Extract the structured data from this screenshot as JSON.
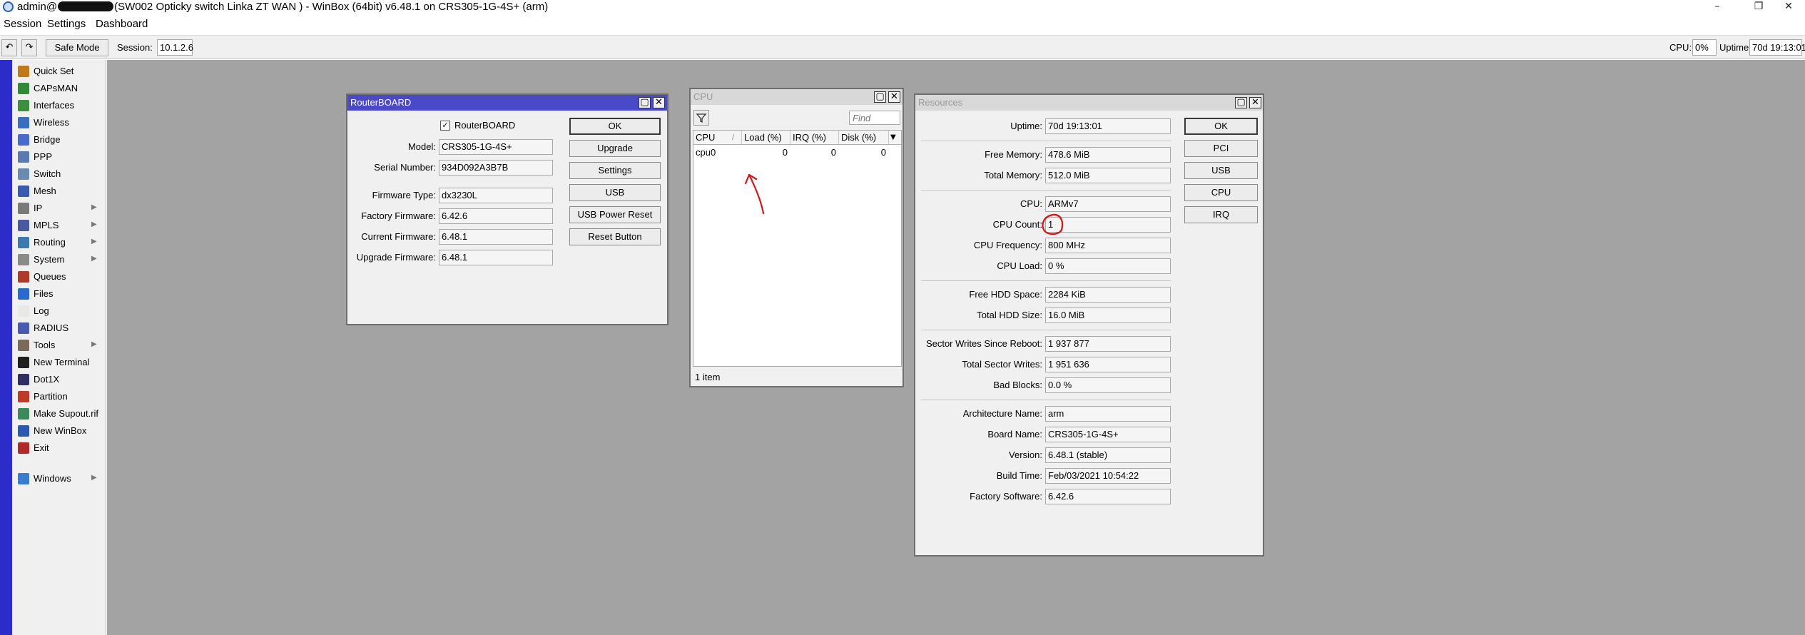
{
  "window": {
    "title_prefix": "admin@",
    "title_suffix": "(SW002 Opticky switch Linka ZT WAN ) - WinBox (64bit) v6.48.1 on CRS305-1G-4S+ (arm)",
    "minimize": "–",
    "restore": "❐",
    "close": "✕"
  },
  "menu": [
    "Session",
    "Settings",
    "Dashboard"
  ],
  "toolbar": {
    "undo_icon": "↶",
    "redo_icon": "↷",
    "safe_mode": "Safe Mode",
    "session_label": "Session:",
    "session_value": "10.1.2.6",
    "cpu_label": "CPU:",
    "cpu_value": "0%",
    "uptime_label": "Uptime:",
    "uptime_value": "70d 19:13:01"
  },
  "sidebar": {
    "items": [
      {
        "label": "Quick Set",
        "icon": "quick-set-icon",
        "color": "#c07a1a",
        "submenu": false
      },
      {
        "label": "CAPsMAN",
        "icon": "capsman-icon",
        "color": "#2f8a3a",
        "submenu": false
      },
      {
        "label": "Interfaces",
        "icon": "interfaces-icon",
        "color": "#3d8f3d",
        "submenu": false
      },
      {
        "label": "Wireless",
        "icon": "wireless-icon",
        "color": "#3a6fc0",
        "submenu": false
      },
      {
        "label": "Bridge",
        "icon": "bridge-icon",
        "color": "#4a6ad0",
        "submenu": false
      },
      {
        "label": "PPP",
        "icon": "ppp-icon",
        "color": "#5a7ab0",
        "submenu": false
      },
      {
        "label": "Switch",
        "icon": "switch-icon",
        "color": "#6a8ab0",
        "submenu": false
      },
      {
        "label": "Mesh",
        "icon": "mesh-icon",
        "color": "#3a5ab0",
        "submenu": false
      },
      {
        "label": "IP",
        "icon": "ip-icon",
        "color": "#7a7a7a",
        "submenu": true
      },
      {
        "label": "MPLS",
        "icon": "mpls-icon",
        "color": "#4a5aa0",
        "submenu": true
      },
      {
        "label": "Routing",
        "icon": "routing-icon",
        "color": "#3a7ab0",
        "submenu": true
      },
      {
        "label": "System",
        "icon": "system-icon",
        "color": "#8a8a8a",
        "submenu": true
      },
      {
        "label": "Queues",
        "icon": "queues-icon",
        "color": "#b03a2a",
        "submenu": false
      },
      {
        "label": "Files",
        "icon": "files-icon",
        "color": "#2a6ad0",
        "submenu": false
      },
      {
        "label": "Log",
        "icon": "log-icon",
        "color": "#e8e8e8",
        "submenu": false
      },
      {
        "label": "RADIUS",
        "icon": "radius-icon",
        "color": "#4a5ab0",
        "submenu": false
      },
      {
        "label": "Tools",
        "icon": "tools-icon",
        "color": "#7a6a5a",
        "submenu": true
      },
      {
        "label": "New Terminal",
        "icon": "terminal-icon",
        "color": "#202020",
        "submenu": false
      },
      {
        "label": "Dot1X",
        "icon": "dot1x-icon",
        "color": "#303060",
        "submenu": false
      },
      {
        "label": "Partition",
        "icon": "partition-icon",
        "color": "#c03a2a",
        "submenu": false
      },
      {
        "label": "Make Supout.rif",
        "icon": "supout-icon",
        "color": "#3a8a5a",
        "submenu": false
      },
      {
        "label": "New WinBox",
        "icon": "winbox-icon",
        "color": "#2a5ab0",
        "submenu": false
      },
      {
        "label": "Exit",
        "icon": "exit-icon",
        "color": "#b02a2a",
        "submenu": false
      }
    ],
    "windows": {
      "label": "Windows",
      "icon": "windows-icon",
      "color": "#3a7ad0",
      "submenu": true
    },
    "submenu_arrow": "▶"
  },
  "routerboard": {
    "title": "RouterBOARD",
    "checkbox_label": "RouterBOARD",
    "checkbox_mark": "✓",
    "fields": [
      {
        "label": "Model:",
        "value": "CRS305-1G-4S+"
      },
      {
        "label": "Serial Number:",
        "value": "934D092A3B7B"
      },
      {
        "label": "Firmware Type:",
        "value": "dx3230L"
      },
      {
        "label": "Factory Firmware:",
        "value": "6.42.6"
      },
      {
        "label": "Current Firmware:",
        "value": "6.48.1"
      },
      {
        "label": "Upgrade Firmware:",
        "value": "6.48.1"
      }
    ],
    "buttons": [
      "OK",
      "Upgrade",
      "Settings",
      "USB",
      "USB Power Reset",
      "Reset Button"
    ]
  },
  "cpu_window": {
    "title": "CPU",
    "find_placeholder": "Find",
    "columns": [
      "CPU",
      "Load (%)",
      "IRQ (%)",
      "Disk (%)"
    ],
    "sort_mark": "/",
    "menu_arrow": "▼",
    "rows": [
      {
        "cpu": "cpu0",
        "load": "0",
        "irq": "0",
        "disk": "0"
      }
    ],
    "status": "1 item"
  },
  "resources": {
    "title": "Resources",
    "fields": [
      {
        "label": "Uptime:",
        "value": "70d 19:13:01"
      },
      {
        "label": "Free Memory:",
        "value": "478.6 MiB"
      },
      {
        "label": "Total Memory:",
        "value": "512.0 MiB"
      },
      {
        "label": "CPU:",
        "value": "ARMv7"
      },
      {
        "label": "CPU Count:",
        "value": "1"
      },
      {
        "label": "CPU Frequency:",
        "value": "800 MHz"
      },
      {
        "label": "CPU Load:",
        "value": "0 %"
      },
      {
        "label": "Free HDD Space:",
        "value": "2284 KiB"
      },
      {
        "label": "Total HDD Size:",
        "value": "16.0 MiB"
      },
      {
        "label": "Sector Writes Since Reboot:",
        "value": "1 937 877"
      },
      {
        "label": "Total Sector Writes:",
        "value": "1 951 636"
      },
      {
        "label": "Bad Blocks:",
        "value": "0.0 %"
      },
      {
        "label": "Architecture Name:",
        "value": "arm"
      },
      {
        "label": "Board Name:",
        "value": "CRS305-1G-4S+"
      },
      {
        "label": "Version:",
        "value": "6.48.1 (stable)"
      },
      {
        "label": "Build Time:",
        "value": "Feb/03/2021 10:54:22"
      },
      {
        "label": "Factory Software:",
        "value": "6.42.6"
      }
    ],
    "buttons": [
      "OK",
      "PCI",
      "USB",
      "CPU",
      "IRQ"
    ]
  },
  "annotation_color": "#d01a1a"
}
